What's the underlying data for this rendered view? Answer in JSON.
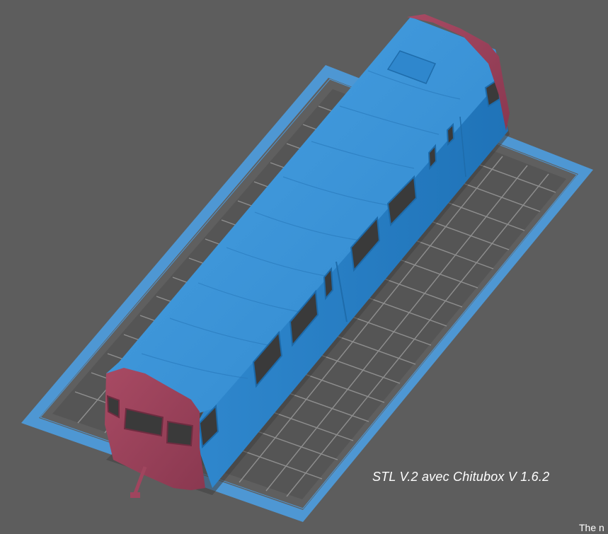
{
  "viewport": {
    "background_color": "#5d5d5d",
    "build_plate_border_color": "#4e97d3",
    "grid_color": "#9a9a9a",
    "model_body_color": "#3a8fd4",
    "model_cab_color": "#a0455e",
    "model": "railcar"
  },
  "caption": {
    "text": "STL V.2 avec Chitubox V 1.6.2"
  },
  "corner_text": {
    "text": "The n"
  }
}
